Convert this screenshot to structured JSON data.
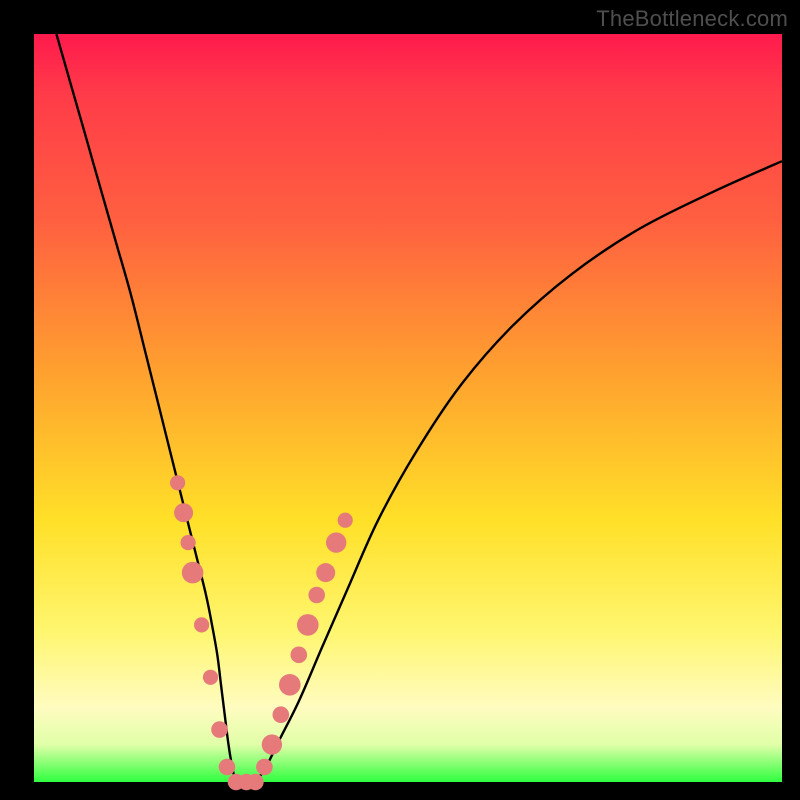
{
  "watermark": "TheBottleneck.com",
  "palette": {
    "frame": "#000000",
    "marker": "#e67a7a",
    "curve": "#000000"
  },
  "chart_data": {
    "type": "line",
    "title": "",
    "xlabel": "",
    "ylabel": "",
    "xlim": [
      0,
      100
    ],
    "ylim": [
      0,
      100
    ],
    "grid": false,
    "legend": false,
    "series": [
      {
        "name": "bottleneck-curve",
        "x": [
          3,
          5,
          7,
          9,
          11,
          13,
          15,
          17,
          19,
          20,
          21,
          22,
          23,
          23.8,
          24.5,
          25,
          25.5,
          26,
          26.5,
          27,
          27.7,
          28.5,
          29.5,
          31,
          33,
          35.5,
          38.5,
          42,
          46,
          51,
          57,
          64,
          72,
          81,
          91,
          100
        ],
        "y": [
          100,
          93,
          86,
          79,
          72,
          65,
          57,
          49,
          41,
          37,
          33,
          29,
          25,
          21,
          17,
          13,
          9,
          5,
          2,
          0,
          0,
          0,
          0,
          2,
          6,
          11,
          18,
          26,
          35,
          44,
          53,
          61,
          68,
          74,
          79,
          83
        ]
      }
    ],
    "markers": [
      {
        "x": 19.2,
        "y": 40,
        "r": 1.2
      },
      {
        "x": 20.0,
        "y": 36,
        "r": 1.5
      },
      {
        "x": 20.6,
        "y": 32,
        "r": 1.2
      },
      {
        "x": 21.2,
        "y": 28,
        "r": 1.7
      },
      {
        "x": 22.4,
        "y": 21,
        "r": 1.2
      },
      {
        "x": 23.6,
        "y": 14,
        "r": 1.2
      },
      {
        "x": 24.8,
        "y": 7,
        "r": 1.3
      },
      {
        "x": 25.8,
        "y": 2,
        "r": 1.3
      },
      {
        "x": 27.0,
        "y": 0,
        "r": 1.3
      },
      {
        "x": 28.4,
        "y": 0,
        "r": 1.3
      },
      {
        "x": 29.6,
        "y": 0,
        "r": 1.3
      },
      {
        "x": 30.8,
        "y": 2,
        "r": 1.3
      },
      {
        "x": 31.8,
        "y": 5,
        "r": 1.6
      },
      {
        "x": 33.0,
        "y": 9,
        "r": 1.3
      },
      {
        "x": 34.2,
        "y": 13,
        "r": 1.7
      },
      {
        "x": 35.4,
        "y": 17,
        "r": 1.3
      },
      {
        "x": 36.6,
        "y": 21,
        "r": 1.7
      },
      {
        "x": 37.8,
        "y": 25,
        "r": 1.3
      },
      {
        "x": 39.0,
        "y": 28,
        "r": 1.5
      },
      {
        "x": 40.4,
        "y": 32,
        "r": 1.6
      },
      {
        "x": 41.6,
        "y": 35,
        "r": 1.2
      }
    ]
  }
}
